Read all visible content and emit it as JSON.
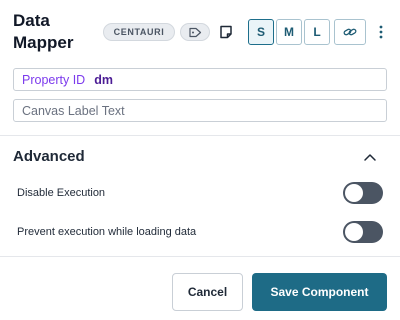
{
  "header": {
    "title": "Data Mapper",
    "badge": "CENTAURI",
    "tag_icon": "tag-icon",
    "note_icon": "note-icon",
    "sizes": [
      {
        "label": "S",
        "active": true
      },
      {
        "label": "M",
        "active": false
      },
      {
        "label": "L",
        "active": false
      }
    ],
    "link_icon": "link-icon",
    "menu_icon": "kebab-menu-icon"
  },
  "fields": {
    "property_id": {
      "label": "Property ID",
      "value": "dm"
    },
    "canvas_label": {
      "placeholder": "Canvas Label Text",
      "value": ""
    }
  },
  "advanced": {
    "title": "Advanced",
    "chevron_icon": "chevron-up-icon",
    "options": [
      {
        "label": "Disable Execution",
        "enabled": false
      },
      {
        "label": "Prevent execution while loading data",
        "enabled": false
      }
    ]
  },
  "footer": {
    "cancel_label": "Cancel",
    "save_label": "Save Component"
  },
  "colors": {
    "primary": "#1e6b86",
    "toggle_off": "#4b5563",
    "property_accent": "#7c3aed"
  }
}
